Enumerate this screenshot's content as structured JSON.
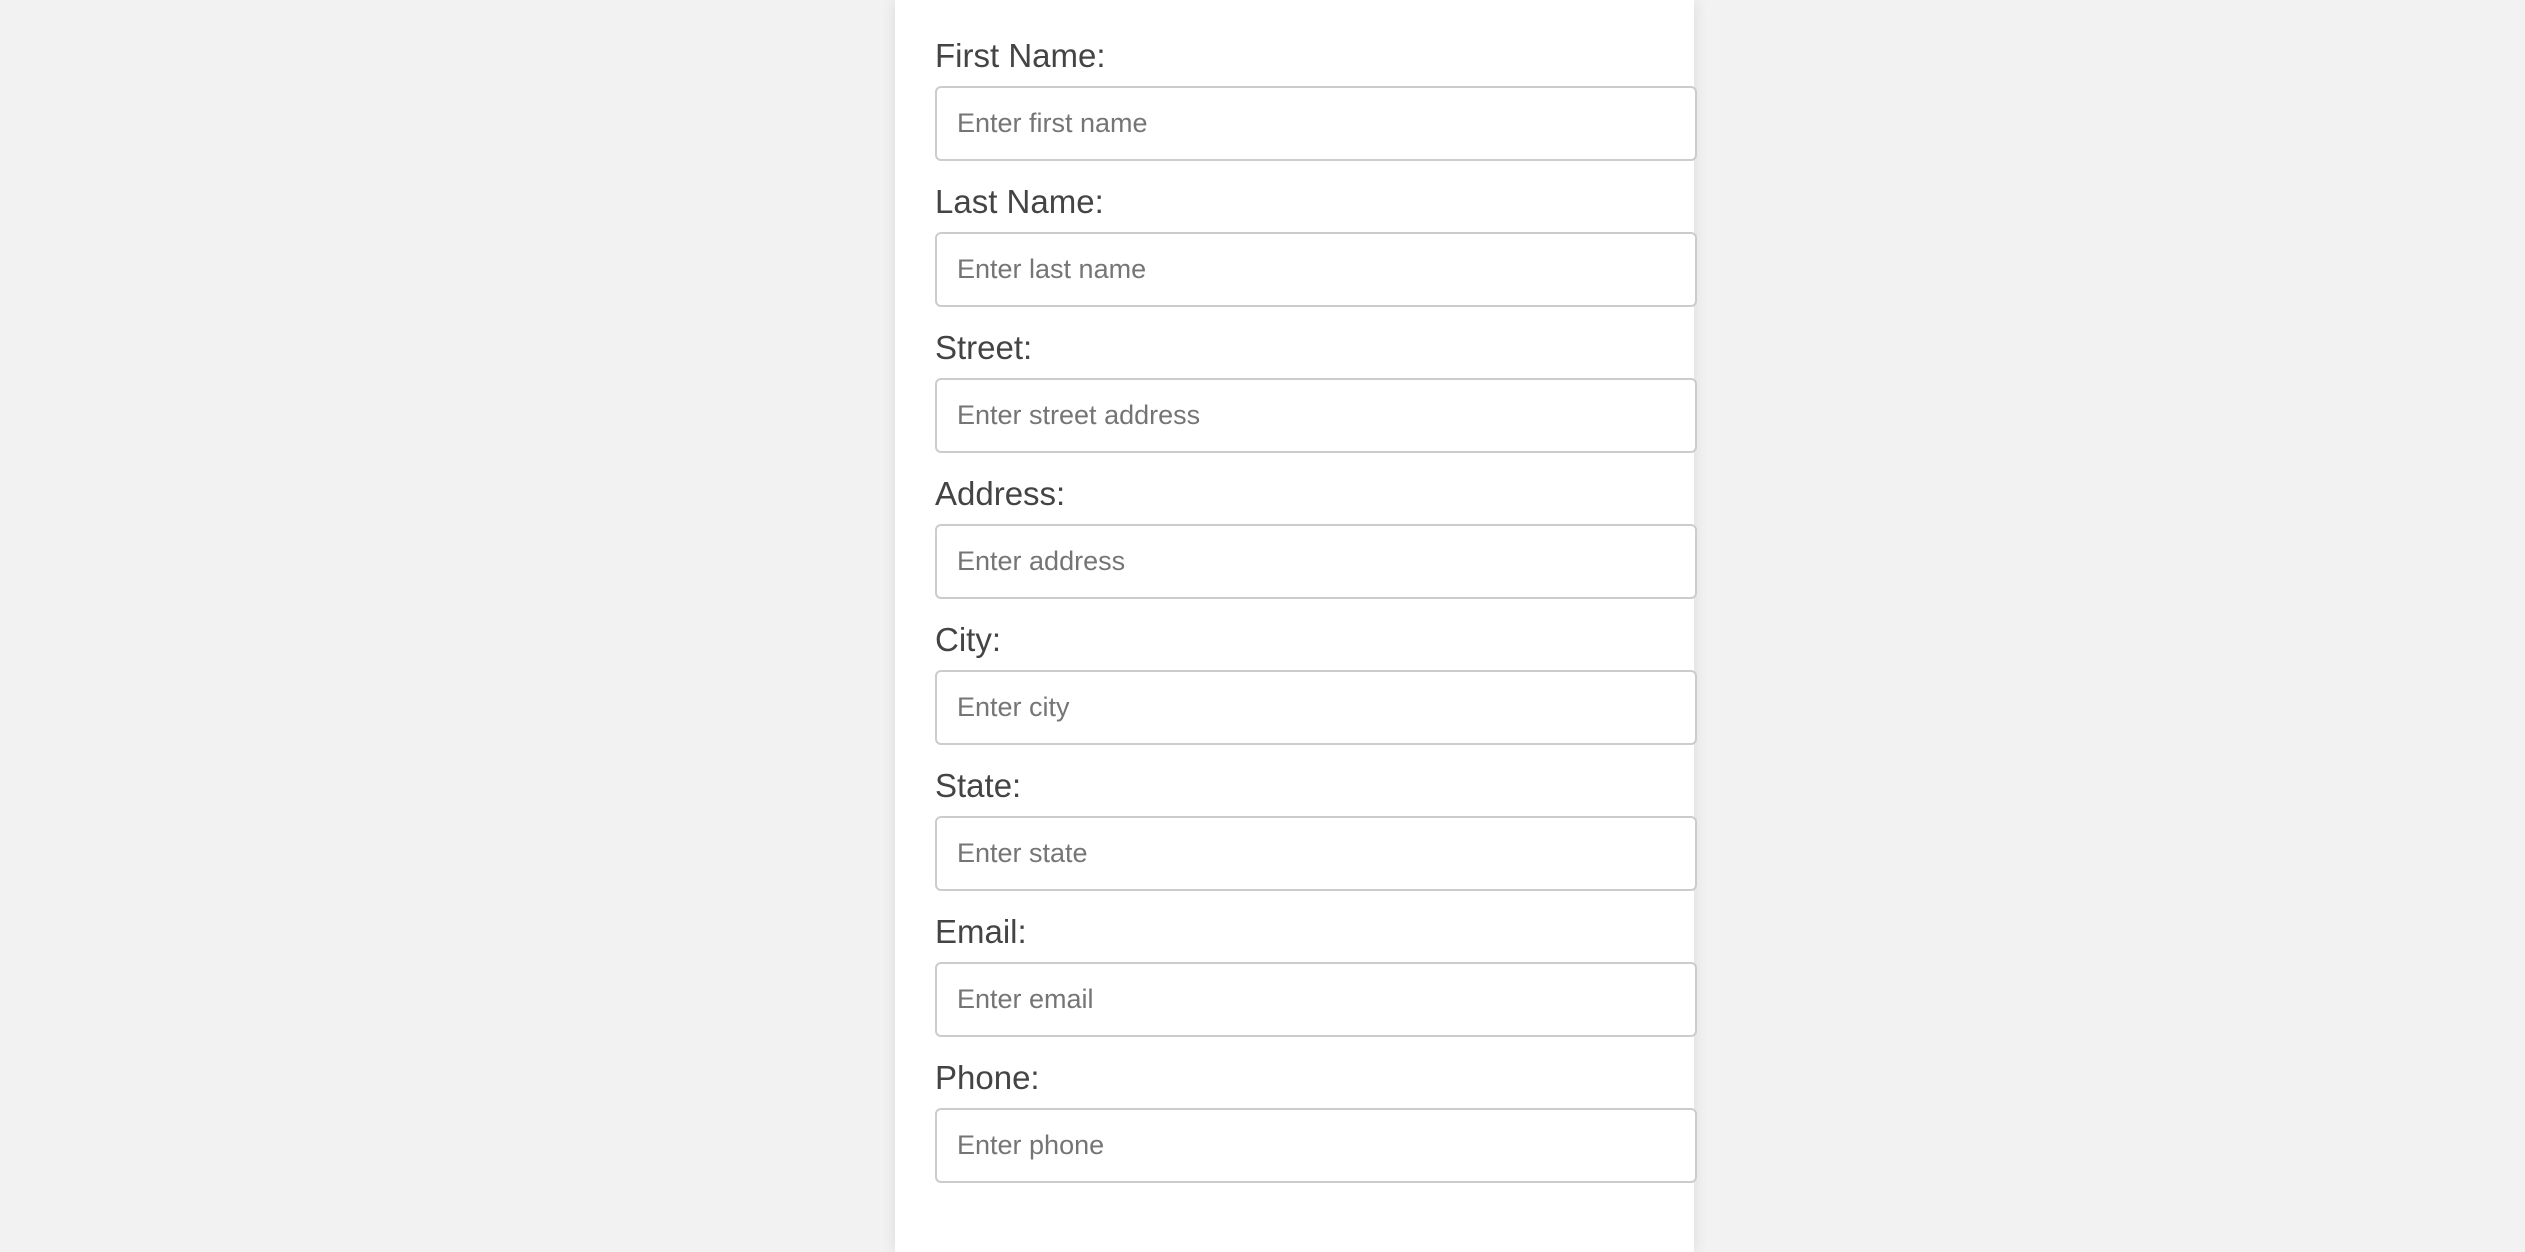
{
  "form": {
    "fields": [
      {
        "label": "First Name:",
        "placeholder": "Enter first name",
        "value": ""
      },
      {
        "label": "Last Name:",
        "placeholder": "Enter last name",
        "value": ""
      },
      {
        "label": "Street:",
        "placeholder": "Enter street address",
        "value": ""
      },
      {
        "label": "Address:",
        "placeholder": "Enter address",
        "value": ""
      },
      {
        "label": "City:",
        "placeholder": "Enter city",
        "value": ""
      },
      {
        "label": "State:",
        "placeholder": "Enter state",
        "value": ""
      },
      {
        "label": "Email:",
        "placeholder": "Enter email",
        "value": ""
      },
      {
        "label": "Phone:",
        "placeholder": "Enter phone",
        "value": ""
      }
    ]
  },
  "colors": {
    "page_background": "#f2f2f2",
    "card_background": "#ffffff",
    "label_text": "#444444",
    "input_border": "#cccccc",
    "placeholder_text": "#757575"
  }
}
